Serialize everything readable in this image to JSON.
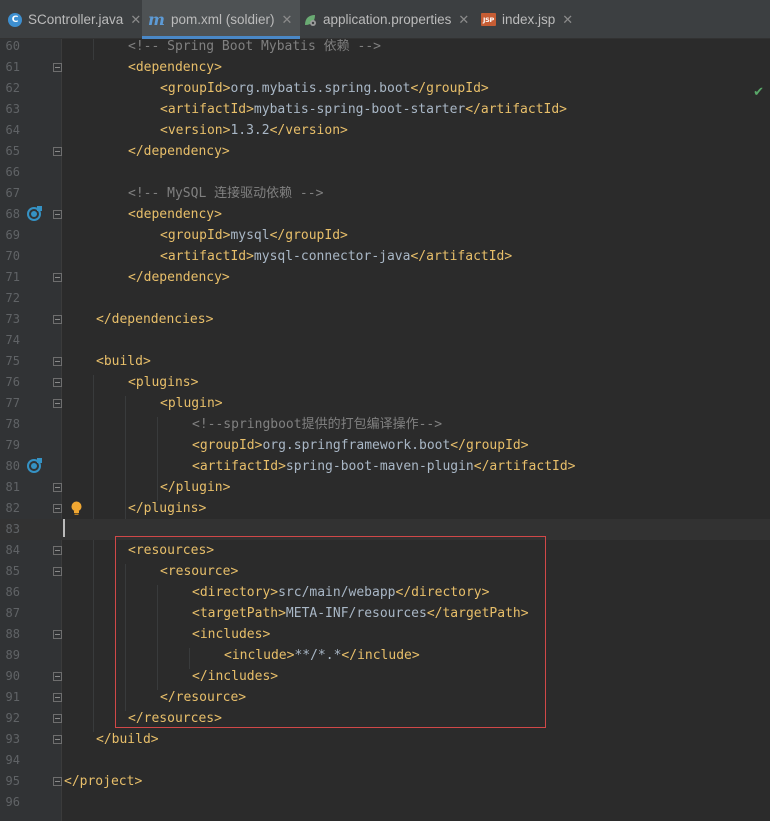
{
  "tabs": [
    {
      "name": "SController.java",
      "icon": "class-icon",
      "active": false
    },
    {
      "name": "pom.xml (soldier)",
      "icon": "maven-icon",
      "active": true
    },
    {
      "name": "application.properties",
      "icon": "spring-config-icon",
      "active": false
    },
    {
      "name": "index.jsp",
      "icon": "jsp-icon",
      "active": false
    }
  ],
  "editor": {
    "status_icon": "inspection-ok-icon",
    "current_line": 83,
    "highlighted_range": [
      84,
      92
    ],
    "lines": [
      {
        "n": "60",
        "indent": 2,
        "parts": [
          [
            "cmt",
            "<!-- Spring Boot Mybatis 依赖 -->"
          ]
        ]
      },
      {
        "n": "61",
        "indent": 2,
        "parts": [
          [
            "tag",
            "<dependency>"
          ]
        ],
        "fold": true
      },
      {
        "n": "62",
        "indent": 3,
        "parts": [
          [
            "tag",
            "<groupId>"
          ],
          [
            "txt",
            "org.mybatis.spring.boot"
          ],
          [
            "tag",
            "</groupId>"
          ]
        ]
      },
      {
        "n": "63",
        "indent": 3,
        "parts": [
          [
            "tag",
            "<artifactId>"
          ],
          [
            "txt",
            "mybatis-spring-boot-starter"
          ],
          [
            "tag",
            "</artifactId>"
          ]
        ]
      },
      {
        "n": "64",
        "indent": 3,
        "parts": [
          [
            "tag",
            "<version>"
          ],
          [
            "txt",
            "1.3.2"
          ],
          [
            "tag",
            "</version>"
          ]
        ]
      },
      {
        "n": "65",
        "indent": 2,
        "parts": [
          [
            "tag",
            "</dependency>"
          ]
        ],
        "fold": true
      },
      {
        "n": "66",
        "indent": 0,
        "parts": []
      },
      {
        "n": "67",
        "indent": 2,
        "parts": [
          [
            "cmt",
            "<!-- MySQL 连接驱动依赖 -->"
          ]
        ]
      },
      {
        "n": "68",
        "indent": 2,
        "parts": [
          [
            "tag",
            "<dependency>"
          ]
        ],
        "fold": true,
        "action": true
      },
      {
        "n": "69",
        "indent": 3,
        "parts": [
          [
            "tag",
            "<groupId>"
          ],
          [
            "txt",
            "mysql"
          ],
          [
            "tag",
            "</groupId>"
          ]
        ]
      },
      {
        "n": "70",
        "indent": 3,
        "parts": [
          [
            "tag",
            "<artifactId>"
          ],
          [
            "txt",
            "mysql-connector-java"
          ],
          [
            "tag",
            "</artifactId>"
          ]
        ]
      },
      {
        "n": "71",
        "indent": 2,
        "parts": [
          [
            "tag",
            "</dependency>"
          ]
        ],
        "fold": true
      },
      {
        "n": "72",
        "indent": 0,
        "parts": []
      },
      {
        "n": "73",
        "indent": 1,
        "parts": [
          [
            "tag",
            "</dependencies>"
          ]
        ],
        "fold": true
      },
      {
        "n": "74",
        "indent": 0,
        "parts": []
      },
      {
        "n": "75",
        "indent": 1,
        "parts": [
          [
            "tag",
            "<build>"
          ]
        ],
        "fold": true
      },
      {
        "n": "76",
        "indent": 2,
        "parts": [
          [
            "tag",
            "<plugins>"
          ]
        ],
        "fold": true
      },
      {
        "n": "77",
        "indent": 3,
        "parts": [
          [
            "tag",
            "<plugin>"
          ]
        ],
        "fold": true
      },
      {
        "n": "78",
        "indent": 4,
        "parts": [
          [
            "cmt",
            "<!--springboot提供的打包编译操作-->"
          ]
        ]
      },
      {
        "n": "79",
        "indent": 4,
        "parts": [
          [
            "tag",
            "<groupId>"
          ],
          [
            "txt",
            "org.springframework.boot"
          ],
          [
            "tag",
            "</groupId>"
          ]
        ]
      },
      {
        "n": "80",
        "indent": 4,
        "parts": [
          [
            "tag",
            "<artifactId>"
          ],
          [
            "txt",
            "spring-boot-maven-plugin"
          ],
          [
            "tag",
            "</artifactId>"
          ]
        ],
        "action": true
      },
      {
        "n": "81",
        "indent": 3,
        "parts": [
          [
            "tag",
            "</plugin>"
          ]
        ],
        "fold": true
      },
      {
        "n": "82",
        "indent": 2,
        "parts": [
          [
            "tag",
            "</plugins>"
          ]
        ],
        "fold": true,
        "bulb": true
      },
      {
        "n": "83",
        "indent": 0,
        "parts": []
      },
      {
        "n": "84",
        "indent": 2,
        "parts": [
          [
            "tag",
            "<resources>"
          ]
        ],
        "fold": true
      },
      {
        "n": "85",
        "indent": 3,
        "parts": [
          [
            "tag",
            "<resource>"
          ]
        ],
        "fold": true
      },
      {
        "n": "86",
        "indent": 4,
        "parts": [
          [
            "tag",
            "<directory>"
          ],
          [
            "txt",
            "src/main/webapp"
          ],
          [
            "tag",
            "</directory>"
          ]
        ]
      },
      {
        "n": "87",
        "indent": 4,
        "parts": [
          [
            "tag",
            "<targetPath>"
          ],
          [
            "txt",
            "META-INF/resources"
          ],
          [
            "tag",
            "</targetPath>"
          ]
        ]
      },
      {
        "n": "88",
        "indent": 4,
        "parts": [
          [
            "tag",
            "<includes>"
          ]
        ],
        "fold": true
      },
      {
        "n": "89",
        "indent": 5,
        "parts": [
          [
            "tag",
            "<include>"
          ],
          [
            "txt",
            "**/*.*"
          ],
          [
            "tag",
            "</include>"
          ]
        ]
      },
      {
        "n": "90",
        "indent": 4,
        "parts": [
          [
            "tag",
            "</includes>"
          ]
        ],
        "fold": true
      },
      {
        "n": "91",
        "indent": 3,
        "parts": [
          [
            "tag",
            "</resource>"
          ]
        ],
        "fold": true
      },
      {
        "n": "92",
        "indent": 2,
        "parts": [
          [
            "tag",
            "</resources>"
          ]
        ],
        "fold": true
      },
      {
        "n": "93",
        "indent": 1,
        "parts": [
          [
            "tag",
            "</build>"
          ]
        ],
        "fold": true
      },
      {
        "n": "94",
        "indent": 0,
        "parts": []
      },
      {
        "n": "95",
        "indent": 0,
        "parts": [
          [
            "tag",
            "</project>"
          ]
        ],
        "fold": true
      },
      {
        "n": "96",
        "indent": 0,
        "parts": []
      }
    ]
  }
}
